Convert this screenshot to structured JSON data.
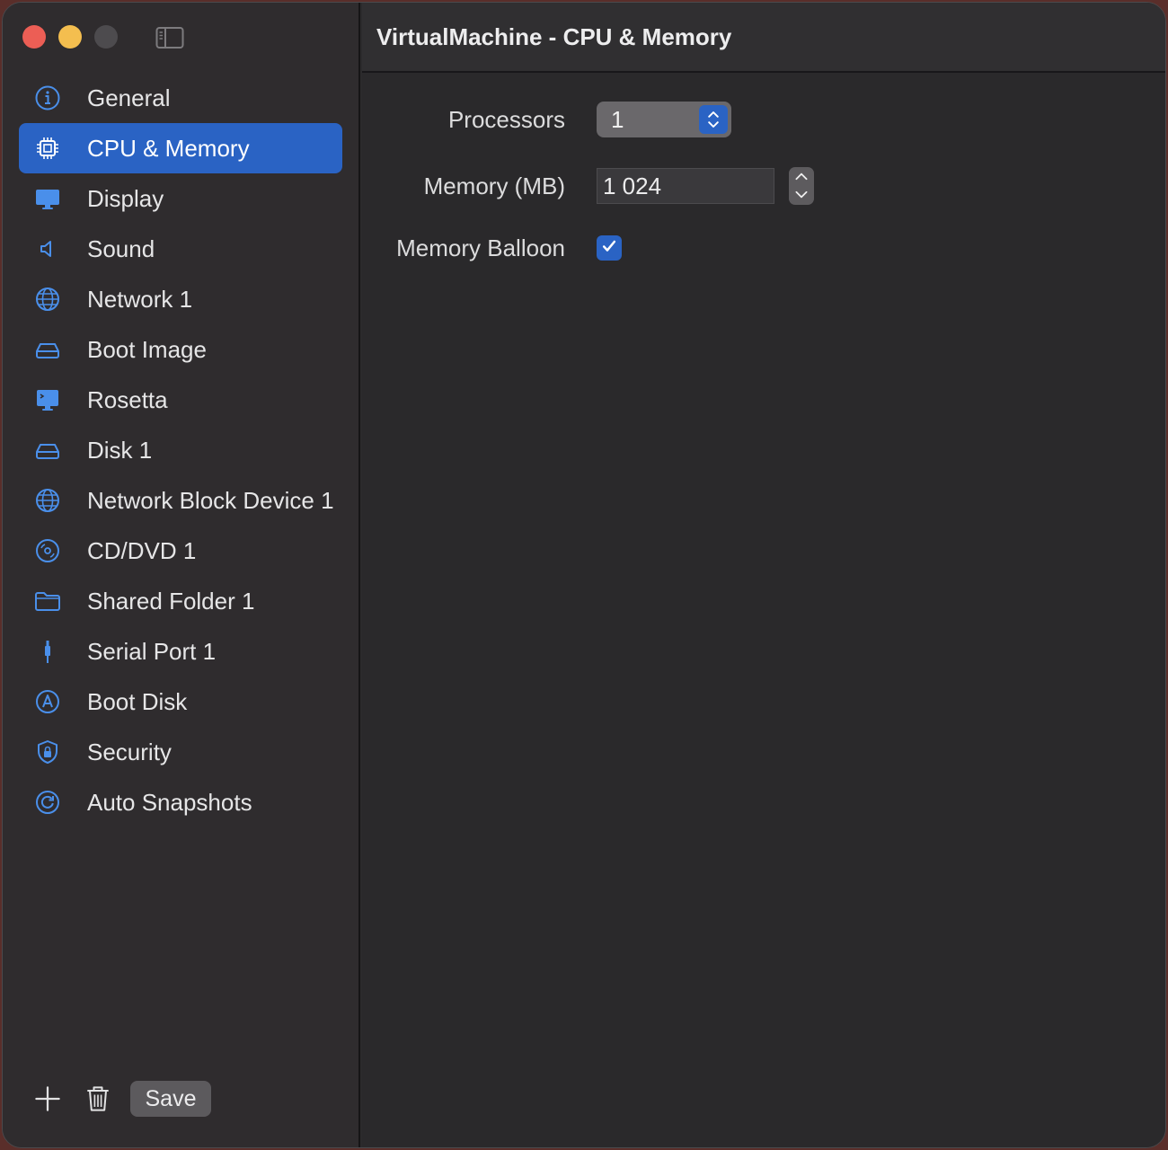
{
  "window": {
    "title": "VirtualMachine - CPU & Memory"
  },
  "sidebar": {
    "items": [
      {
        "label": "General",
        "icon": "info-icon",
        "active": false
      },
      {
        "label": "CPU & Memory",
        "icon": "cpu-icon",
        "active": true
      },
      {
        "label": "Display",
        "icon": "display-icon",
        "active": false
      },
      {
        "label": "Sound",
        "icon": "speaker-icon",
        "active": false
      },
      {
        "label": "Network 1",
        "icon": "globe-icon",
        "active": false
      },
      {
        "label": "Boot Image",
        "icon": "drive-icon",
        "active": false
      },
      {
        "label": "Rosetta",
        "icon": "terminal-display-icon",
        "active": false
      },
      {
        "label": "Disk 1",
        "icon": "drive-icon",
        "active": false
      },
      {
        "label": "Network Block Device 1",
        "icon": "globe-icon",
        "active": false
      },
      {
        "label": "CD/DVD 1",
        "icon": "disc-icon",
        "active": false
      },
      {
        "label": "Shared Folder 1",
        "icon": "folder-icon",
        "active": false
      },
      {
        "label": "Serial Port 1",
        "icon": "cable-connector-icon",
        "active": false
      },
      {
        "label": "Boot Disk",
        "icon": "startup-disk-icon",
        "active": false
      },
      {
        "label": "Security",
        "icon": "shield-lock-icon",
        "active": false
      },
      {
        "label": "Auto Snapshots",
        "icon": "clock-arrow-icon",
        "active": false
      }
    ],
    "footer": {
      "save_label": "Save"
    }
  },
  "form": {
    "processors": {
      "label": "Processors",
      "value": "1"
    },
    "memory": {
      "label": "Memory (MB)",
      "value": "1 024"
    },
    "memory_balloon": {
      "label": "Memory Balloon",
      "checked": true
    }
  },
  "colors": {
    "accent": "#2a63c4",
    "icon_blue": "#4a8fea"
  }
}
